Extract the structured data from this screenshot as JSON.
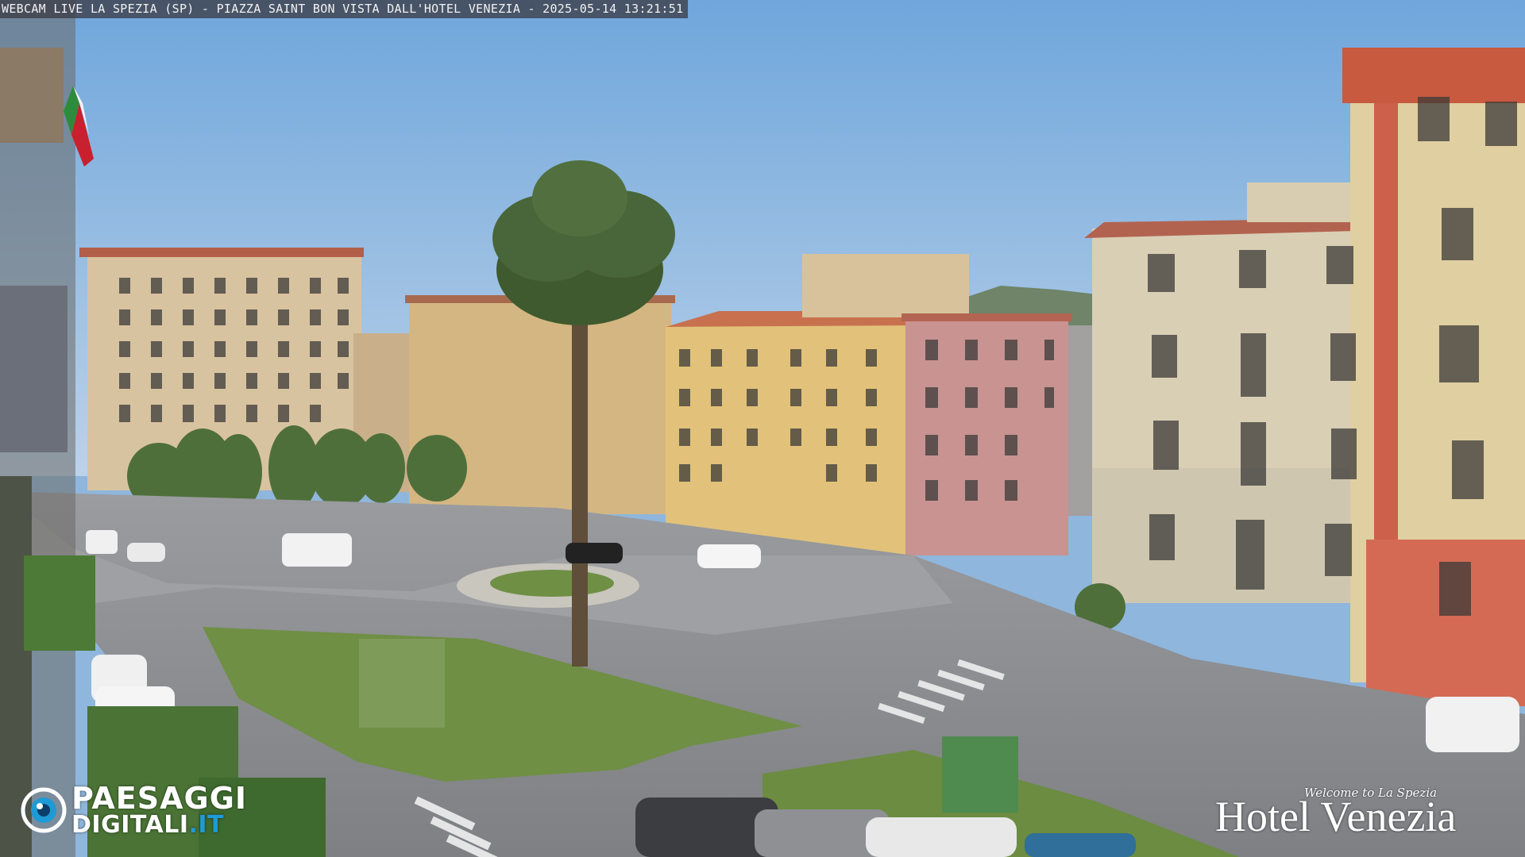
{
  "overlay": {
    "caption": "WEBCAM LIVE LA SPEZIA (SP) - PIAZZA SAINT BON VISTA DALL'HOTEL VENEZIA - 2025-05-14 13:21:51"
  },
  "logos": {
    "left_line1": "PAESAGGI",
    "left_line2_main": "DIGITALI",
    "left_line2_tld": ".IT",
    "right_tagline": "Welcome to La Spezia",
    "right_name": "Hotel Venezia"
  },
  "colors": {
    "sky_top": "#7aaee0",
    "sky_bottom": "#b9d0e6",
    "road": "#8b8d91",
    "grass": "#6f8f45",
    "building_cream": "#d9c9a8",
    "building_pink": "#c98f8a",
    "building_red": "#d06a50",
    "accent_blue": "#1e9ad6"
  }
}
